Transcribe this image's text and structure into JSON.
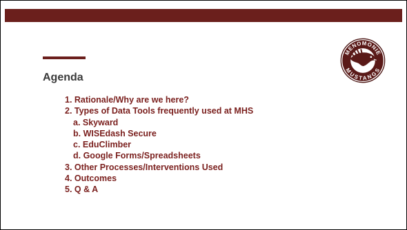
{
  "slide": {
    "title": "Agenda",
    "items": [
      {
        "text": "1. Rationale/Why are we here?",
        "level": 1
      },
      {
        "text": "2. Types of Data Tools frequently used at MHS",
        "level": 1
      },
      {
        "text": "a. Skyward",
        "level": 2
      },
      {
        "text": "b. WISEdash Secure",
        "level": 2
      },
      {
        "text": "c. EduClimber",
        "level": 2
      },
      {
        "text": "d. Google Forms/Spreadsheets",
        "level": 2
      },
      {
        "text": "3. Other Processes/Interventions Used",
        "level": 1
      },
      {
        "text": "4. Outcomes",
        "level": 1
      },
      {
        "text": "5. Q & A",
        "level": 1
      }
    ]
  },
  "logo": {
    "top_text": "MENOMONIE",
    "bottom_text": "MUSTANGS",
    "icon": "mustang-horse-icon"
  },
  "colors": {
    "brand": "#6b1f1c",
    "text": "#7a1f1d",
    "title": "#3a3a3a"
  }
}
